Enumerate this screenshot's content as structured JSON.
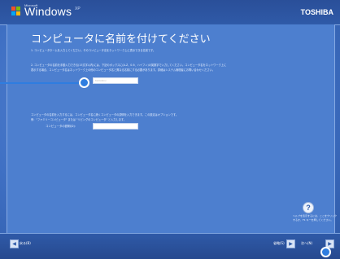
{
  "window": {
    "logo_ms": "Microsoft",
    "logo_text": "Windows",
    "logo_edition": "XP",
    "brand": "TOSHIBA"
  },
  "page": {
    "title": "コンピュータに名前を付けてください",
    "para1": "1. コンピュータネームを入力してください。そのコンピュータ名をネットワーク上に表示できる名前です。",
    "para2a": "2. コンピュータの名前を手動入力できる(15文字以内)には、下記のボックスに(A-Z、0-9、ハイフン)の英数字で入力してください。コンピュータ名をネットワーク上に",
    "para2b": "  表示する場合、コンピュータ名はネットワーク上の他のコンピュータ名と異なる名前にする必要があります。詳細はシステム管理者にお問い合わせください。",
    "name_input_value": "MAYANIQ",
    "para3a": "コンピュータの名前を入力するには、コンピュータ名に続くコンピュータの説明を入力できます。この設定はオプションです。",
    "para3b": "例：\"ファミリーコンピュータ\" または \"リビングのコンピュータ\" と入力します。",
    "description_label": "コンピュータの説明(D):",
    "description_value": ""
  },
  "help": {
    "line1": "ヘルプを表示するには、ここをクリック",
    "line2": "するか、F1 キーを押してください。"
  },
  "footer": {
    "back_label": "戻る(B)",
    "skip_label": "省略(S)",
    "next_label": "次へ(N)"
  },
  "colors": {
    "accent": "#2f7de0",
    "background": "#4d7fcf",
    "bar": "#2f5aa8"
  }
}
